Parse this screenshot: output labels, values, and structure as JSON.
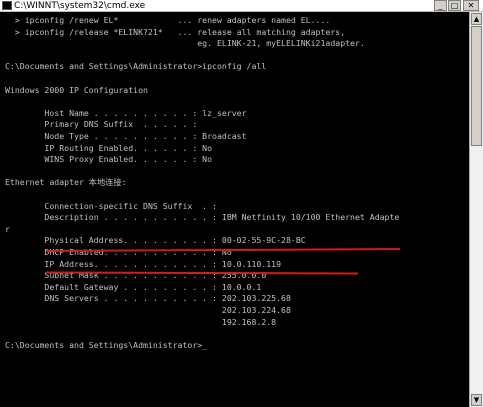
{
  "window": {
    "title": "C:\\WINNT\\system32\\cmd.exe",
    "buttons": {
      "minimize": "_",
      "maximize": "□",
      "close": "✕"
    }
  },
  "console": {
    "lines": [
      "  > ipconfig /renew EL*            ... renew adapters named EL....",
      "  > ipconfig /release *ELINK?21*   ... release all matching adapters,",
      "                                       eg. ELINK-21, myELELINKi21adapter.",
      "",
      "C:\\Documents and Settings\\Administrator>ipconfig /all",
      "",
      "Windows 2000 IP Configuration",
      "",
      "        Host Name . . . . . . . . . . : lz_server",
      "        Primary DNS Suffix  . . . . . :",
      "        Node Type . . . . . . . . . . : Broadcast",
      "        IP Routing Enabled. . . . . . : No",
      "        WINS Proxy Enabled. . . . . . : No",
      "",
      "Ethernet adapter 本地连接:",
      "",
      "        Connection-specific DNS Suffix  . :",
      "        Description . . . . . . . . . . . : IBM Netfinity 10/100 Ethernet Adapte",
      "r",
      "        Physical Address. . . . . . . . . : 00-02-55-9C-28-BC",
      "        DHCP Enabled. . . . . . . . . . . : No",
      "        IP Address. . . . . . . . . . . . : 10.0.110.119",
      "        Subnet Mask . . . . . . . . . . . : 255.0.0.0",
      "        Default Gateway . . . . . . . . . : 10.0.0.1",
      "        DNS Servers . . . . . . . . . . . : 202.103.225.68",
      "                                            202.103.224.68",
      "                                            192.168.2.8",
      "",
      "C:\\Documents and Settings\\Administrator>_"
    ]
  },
  "annotations": {
    "underline_color": "#cc1f1f"
  }
}
